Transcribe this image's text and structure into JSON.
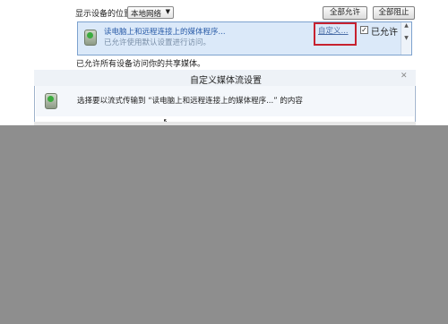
{
  "location_label": "显示设备的位置:",
  "location_select": "本地网络",
  "allow_all_label": "全部允许",
  "block_all_label": "全部阻止",
  "device": {
    "name": "读电脑上和远程连接上的媒体程序...",
    "description": "已允许使用默认设置进行访问。",
    "customize_link": "自定义...",
    "allowed_checked": true,
    "allowed_label": "已允许",
    "icon": "media-library-icon"
  },
  "status_text": "已允许所有设备访问你的共享媒体。",
  "dialog": {
    "title": "自定义媒体流设置",
    "close_glyph": "✕",
    "instruction": "选择要以流式传输到 “读电脑上和远程连接上的媒体程序...” 的内容"
  },
  "colors": {
    "panel_bg": "#dbe9f9",
    "highlight_box": "#c7212f",
    "link": "#4a6ea8",
    "overlay": "#8e8e8e"
  }
}
